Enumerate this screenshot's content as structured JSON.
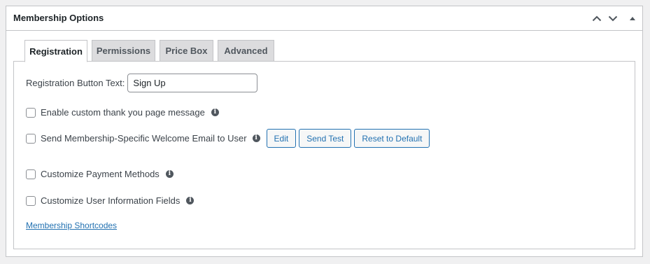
{
  "panel": {
    "title": "Membership Options",
    "controls": {
      "move_up": "chevron-up-icon",
      "move_down": "chevron-down-icon",
      "toggle": "triangle-up-icon"
    }
  },
  "tabs": [
    {
      "label": "Registration",
      "active": true
    },
    {
      "label": "Permissions",
      "active": false
    },
    {
      "label": "Price Box",
      "active": false
    },
    {
      "label": "Advanced",
      "active": false
    }
  ],
  "registration": {
    "button_text_label": "Registration Button Text:",
    "button_text_value": "Sign Up",
    "options": [
      {
        "label": "Enable custom thank you page message",
        "checked": false
      },
      {
        "label": "Send Membership-Specific Welcome Email to User",
        "checked": false
      },
      {
        "label": "Customize Payment Methods",
        "checked": false
      },
      {
        "label": "Customize User Information Fields",
        "checked": false
      }
    ],
    "email_buttons": {
      "edit": "Edit",
      "send_test": "Send Test",
      "reset": "Reset to Default"
    },
    "shortcodes_link": "Membership Shortcodes"
  },
  "colors": {
    "accent": "#2271b1",
    "border": "#c3c4c7",
    "background": "#f0f0f1"
  }
}
